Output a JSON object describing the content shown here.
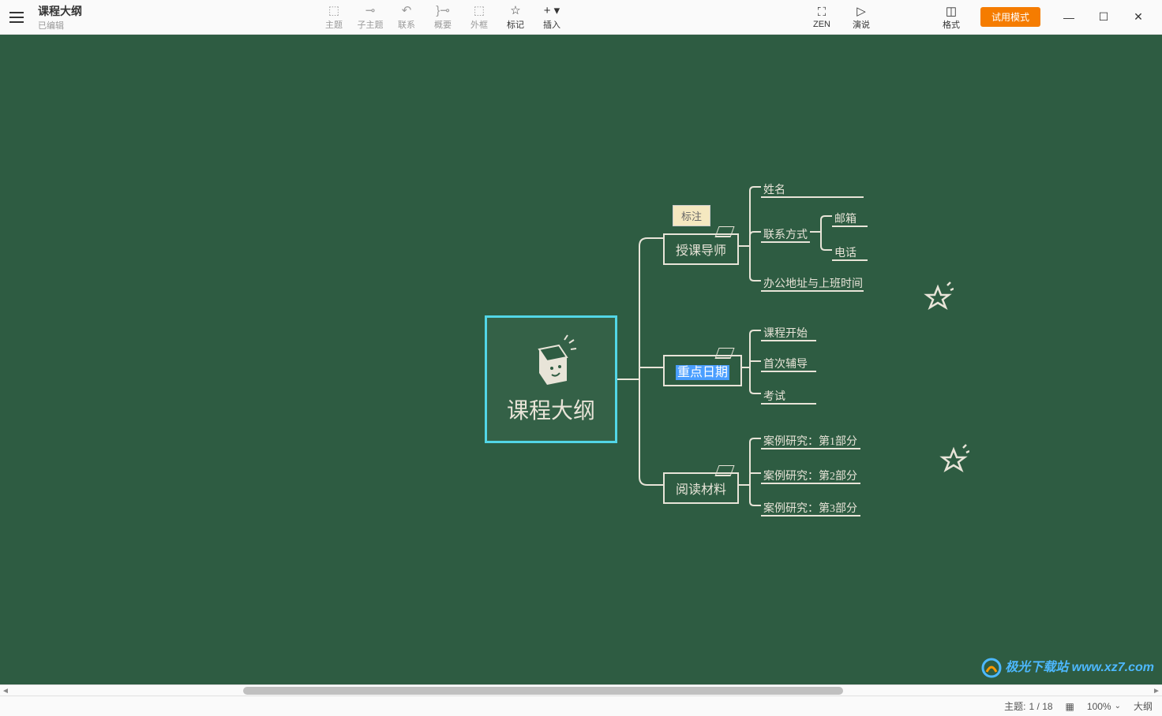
{
  "header": {
    "title": "课程大纲",
    "subtitle": "已编辑"
  },
  "toolbar": {
    "topic": "主题",
    "subtopic": "子主题",
    "relation": "联系",
    "summary": "概要",
    "boundary": "外框",
    "marker": "标记",
    "insert": "插入",
    "zen": "ZEN",
    "present": "演说",
    "format": "格式",
    "trial": "试用模式"
  },
  "mindmap": {
    "root": "课程大纲",
    "note_label": "标注",
    "branches": [
      {
        "label": "授课导师",
        "children": [
          {
            "label": "姓名"
          },
          {
            "label": "联系方式",
            "children": [
              "邮箱",
              "电话"
            ]
          },
          {
            "label": "办公地址与上班时间"
          }
        ]
      },
      {
        "label": "重点日期",
        "selected": true,
        "children": [
          {
            "label": "课程开始"
          },
          {
            "label": "首次辅导"
          },
          {
            "label": "考试"
          }
        ]
      },
      {
        "label": "阅读材料",
        "children": [
          {
            "label": "案例研究：第1部分"
          },
          {
            "label": "案例研究：第2部分"
          },
          {
            "label": "案例研究：第3部分"
          }
        ]
      }
    ]
  },
  "status": {
    "topic_prefix": "主题:",
    "topic_count": "1 / 18",
    "zoom": "100%",
    "view": "大纲"
  },
  "watermark": "极光下载站 www.xz7.com"
}
